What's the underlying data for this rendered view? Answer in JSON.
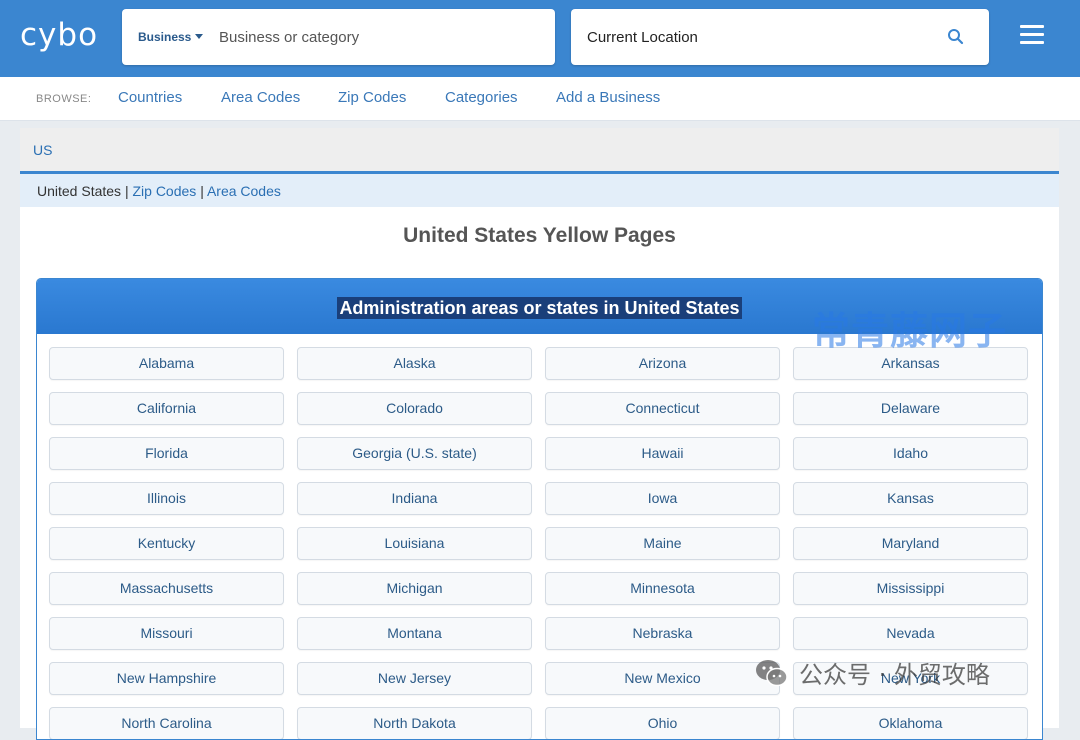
{
  "header": {
    "logo": "cybo",
    "business_type": "Business",
    "business_placeholder": "Business or category",
    "location_value": "Current Location"
  },
  "nav": {
    "browse_label": "BROWSE:",
    "links": [
      "Countries",
      "Area Codes",
      "Zip Codes",
      "Categories",
      "Add a Business"
    ]
  },
  "country_bar": {
    "label": "US"
  },
  "breadcrumb": {
    "current": "United States",
    "sep": "|",
    "links": [
      "Zip Codes",
      "Area Codes"
    ]
  },
  "page_title": "United States Yellow Pages",
  "states_section": {
    "heading": "Administration areas or states in United States",
    "states": [
      "Alabama",
      "Alaska",
      "Arizona",
      "Arkansas",
      "California",
      "Colorado",
      "Connecticut",
      "Delaware",
      "Florida",
      "Georgia (U.S. state)",
      "Hawaii",
      "Idaho",
      "Illinois",
      "Indiana",
      "Iowa",
      "Kansas",
      "Kentucky",
      "Louisiana",
      "Maine",
      "Maryland",
      "Massachusetts",
      "Michigan",
      "Minnesota",
      "Mississippi",
      "Missouri",
      "Montana",
      "Nebraska",
      "Nevada",
      "New Hampshire",
      "New Jersey",
      "New Mexico",
      "New York",
      "North Carolina",
      "North Dakota",
      "Ohio",
      "Oklahoma"
    ]
  },
  "watermarks": {
    "top_right": "常青藤网子",
    "bottom_right": "公众号 · 外贸攻略"
  },
  "colors": {
    "header_blue": "#3b86d0",
    "link_blue": "#3a78b8",
    "heading_blue": "#2f80d8"
  },
  "icons": [
    "search-icon",
    "menu-icon",
    "caret-down-icon",
    "wechat-icon"
  ]
}
